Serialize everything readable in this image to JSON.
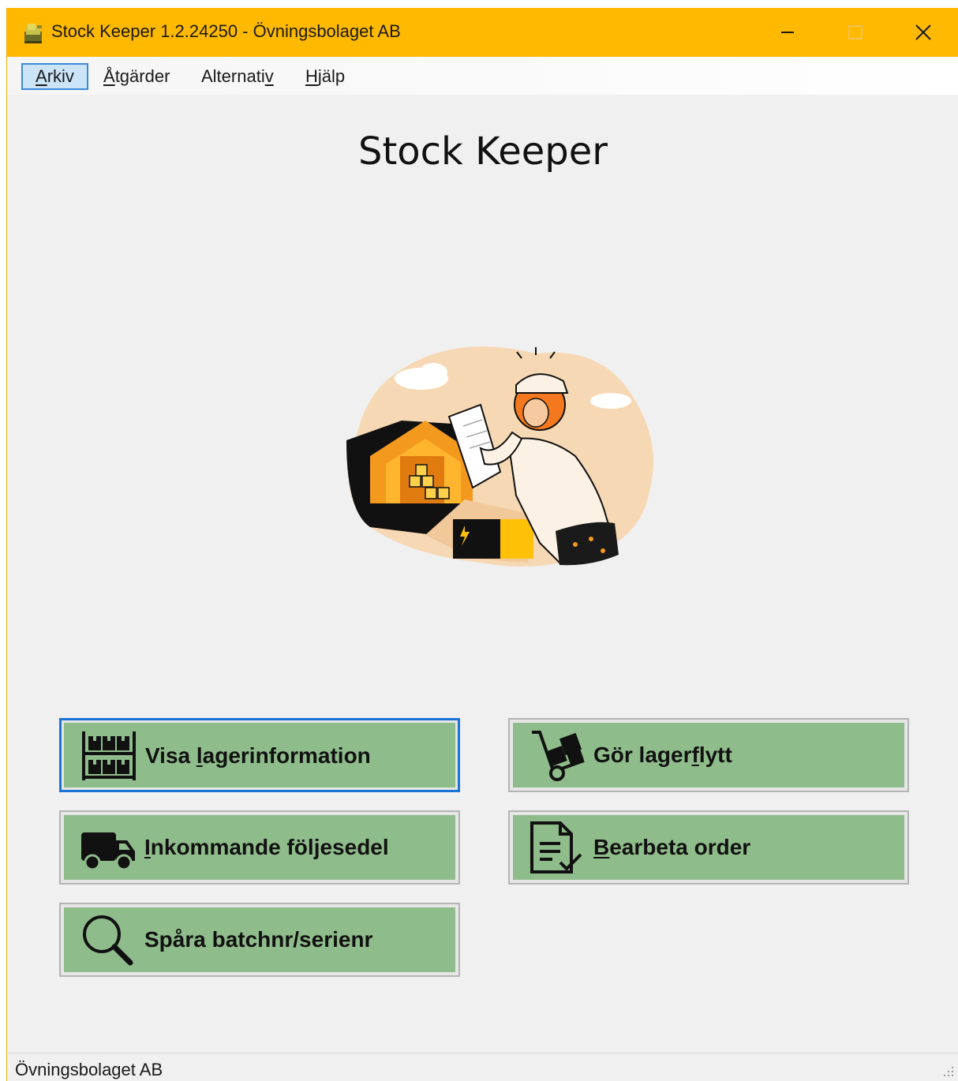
{
  "window": {
    "title": "Stock Keeper 1.2.24250 - Övningsbolaget AB",
    "app_icon": "stock-keeper-app-icon",
    "accent_color": "#ffb900",
    "controls": {
      "minimize_icon": "minimize-icon",
      "maximize_icon": "maximize-icon",
      "close_icon": "close-icon"
    }
  },
  "menu": {
    "items": [
      {
        "pre": "",
        "key": "A",
        "post": "rkiv"
      },
      {
        "pre": "",
        "key": "Å",
        "post": "tgärder"
      },
      {
        "pre": "Alternati",
        "key": "v",
        "post": ""
      },
      {
        "pre": "",
        "key": "H",
        "post": "jälp"
      }
    ]
  },
  "heading": "Stock Keeper",
  "illustration": "warehouse-worker-checklist-illustration",
  "buttons": {
    "color": "#8fbc8b",
    "visa": {
      "pre": "Visa ",
      "key": "l",
      "post": "agerinformation",
      "icon": "warehouse-shelves-icon"
    },
    "lagerflytt": {
      "pre": "Gör lager",
      "key": "f",
      "post": "lytt",
      "icon": "hand-truck-icon"
    },
    "inkommande": {
      "pre": "",
      "key": "I",
      "post": "nkommande följesedel",
      "icon": "delivery-truck-icon"
    },
    "bearbeta": {
      "pre": "",
      "key": "B",
      "post": "earbeta order",
      "icon": "document-check-icon"
    },
    "spara": {
      "pre": "",
      "key": "",
      "post": "Spåra batchnr/serienr",
      "icon": "magnifier-icon"
    }
  },
  "statusbar": {
    "text": "Övningsbolaget AB"
  }
}
